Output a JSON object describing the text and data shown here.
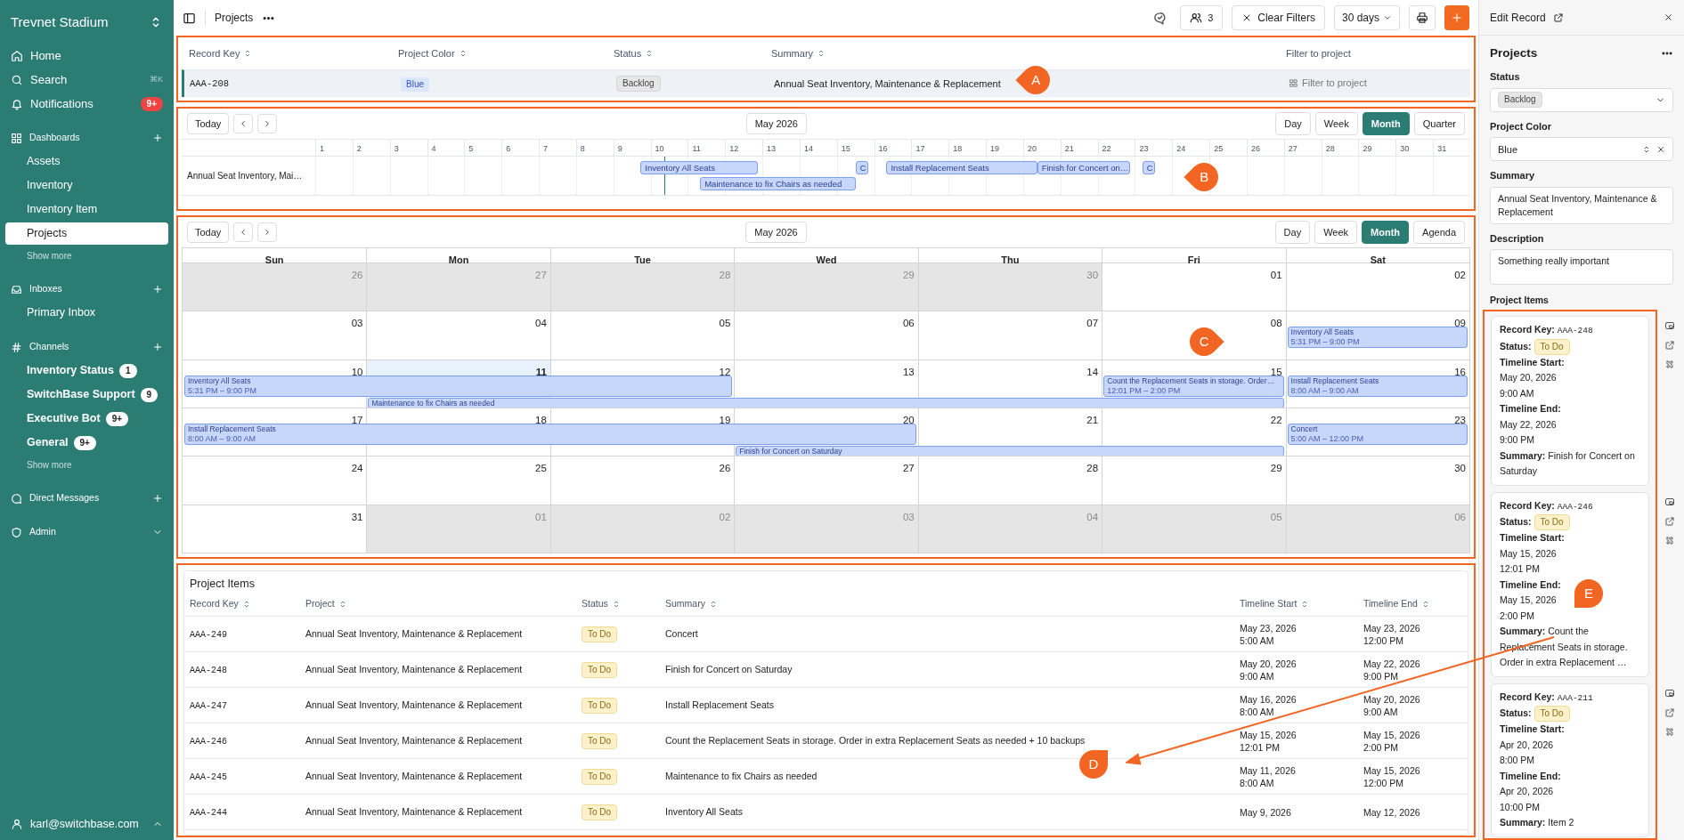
{
  "sidebar": {
    "workspace": "Trevnet Stadium",
    "nav": [
      {
        "kind": "home",
        "label": "Home"
      },
      {
        "kind": "search",
        "label": "Search",
        "shortcut": "⌘K"
      },
      {
        "kind": "bell",
        "label": "Notifications",
        "badge": "9+"
      }
    ],
    "groups": [
      {
        "kind": "dashboard",
        "title": "Dashboards",
        "items": [
          {
            "label": "Assets",
            "selected": false
          },
          {
            "label": "Inventory",
            "selected": false
          },
          {
            "label": "Inventory Item",
            "selected": false
          },
          {
            "label": "Projects",
            "selected": true
          }
        ],
        "more": "Show more"
      },
      {
        "kind": "inbox",
        "title": "Inboxes",
        "items": [
          {
            "label": "Primary Inbox",
            "selected": false
          }
        ]
      },
      {
        "kind": "hash",
        "title": "Channels",
        "items": [
          {
            "label": "Inventory Status",
            "badge": "1",
            "selected": false,
            "unread": true
          },
          {
            "label": "SwitchBase Support",
            "badge": "9",
            "selected": false,
            "unread": true
          },
          {
            "label": "Executive Bot",
            "badge": "9+",
            "selected": false,
            "unread": true
          },
          {
            "label": "General",
            "badge": "9+",
            "selected": false,
            "unread": true
          }
        ],
        "more": "Show more"
      },
      {
        "kind": "chat",
        "title": "Direct Messages"
      },
      {
        "kind": "shield",
        "title": "Admin"
      }
    ],
    "user": "karl@switchbase.com"
  },
  "topbar": {
    "title": "Projects",
    "members": "3",
    "clear_filters": "Clear Filters",
    "range": "30 days"
  },
  "record_table": {
    "columns": [
      {
        "label": "Record Key",
        "sortable": true
      },
      {
        "label": "Project Color",
        "sortable": true
      },
      {
        "label": "Status",
        "sortable": true
      },
      {
        "label": "Summary",
        "sortable": true
      },
      {
        "label": "Filter to project",
        "sortable": false
      }
    ],
    "rows": [
      {
        "selected": true,
        "record_key": "AAA-208",
        "project_color": "Blue",
        "status": {
          "label": "Backlog",
          "kind": "backlog"
        },
        "summary": "Annual Seat Inventory, Maintenance & Replacement",
        "filter_link": "Filter to project"
      }
    ]
  },
  "timeline": {
    "today": "Today",
    "period": "May 2026",
    "views": [
      {
        "label": "Day",
        "selected": false
      },
      {
        "label": "Week",
        "selected": false
      },
      {
        "label": "Month",
        "selected": true
      },
      {
        "label": "Quarter",
        "selected": false
      }
    ],
    "days": [
      "1",
      "2",
      "3",
      "4",
      "5",
      "6",
      "7",
      "8",
      "9",
      "10",
      "11",
      "12",
      "13",
      "14",
      "15",
      "16",
      "17",
      "18",
      "19",
      "20",
      "21",
      "22",
      "23",
      "24",
      "25",
      "26",
      "27",
      "28",
      "29",
      "30",
      "31"
    ],
    "rows": [
      {
        "label": "Annual Seat Inventory, Mai…",
        "bars": [
          {
            "title": "Inventory All Seats"
          },
          {
            "title": "Maintenance to fix Chairs as needed"
          },
          {
            "title": "C"
          },
          {
            "title": "Install Replacement Seats"
          },
          {
            "title": "Finish for Concert on…"
          },
          {
            "title": "C"
          }
        ]
      }
    ]
  },
  "calendar": {
    "today": "Today",
    "period": "May 2026",
    "views": [
      {
        "label": "Day",
        "selected": false
      },
      {
        "label": "Week",
        "selected": false
      },
      {
        "label": "Month",
        "selected": true
      },
      {
        "label": "Agenda",
        "selected": false
      }
    ],
    "weekdays": [
      "Sun",
      "Mon",
      "Tue",
      "Wed",
      "Thu",
      "Fri",
      "Sat"
    ],
    "weeks": [
      {
        "days": [
          {
            "date": "26",
            "outside": true,
            "today": false
          },
          {
            "date": "27",
            "outside": true,
            "today": false
          },
          {
            "date": "28",
            "outside": true,
            "today": false
          },
          {
            "date": "29",
            "outside": true,
            "today": false
          },
          {
            "date": "30",
            "outside": true,
            "today": false
          },
          {
            "date": "01",
            "outside": false,
            "today": false
          },
          {
            "date": "02",
            "outside": false,
            "today": false
          }
        ]
      },
      {
        "days": [
          {
            "date": "03",
            "outside": false,
            "today": false
          },
          {
            "date": "04",
            "outside": false,
            "today": false
          },
          {
            "date": "05",
            "outside": false,
            "today": false
          },
          {
            "date": "06",
            "outside": false,
            "today": false
          },
          {
            "date": "07",
            "outside": false,
            "today": false
          },
          {
            "date": "08",
            "outside": false,
            "today": false
          },
          {
            "date": "09",
            "outside": false,
            "today": false
          }
        ],
        "events": [
          {
            "title": "Inventory All Seats",
            "time": "5:31 PM – 9:00 PM"
          }
        ]
      },
      {
        "days": [
          {
            "date": "10",
            "outside": false,
            "today": false
          },
          {
            "date": "11",
            "outside": false,
            "today": true
          },
          {
            "date": "12",
            "outside": false,
            "today": false
          },
          {
            "date": "13",
            "outside": false,
            "today": false
          },
          {
            "date": "14",
            "outside": false,
            "today": false
          },
          {
            "date": "15",
            "outside": false,
            "today": false
          },
          {
            "date": "16",
            "outside": false,
            "today": false
          }
        ],
        "events": [
          {
            "title": "Inventory All Seats",
            "time": "5:31 PM – 9:00 PM"
          },
          {
            "title": "Count the Replacement Seats in storage. Order…",
            "time": "12:01 PM – 2:00 PM"
          },
          {
            "title": "Install Replacement Seats",
            "time": "8:00 AM – 9:00 AM"
          },
          {
            "title": "Maintenance to fix Chairs as needed"
          }
        ]
      },
      {
        "days": [
          {
            "date": "17",
            "outside": false,
            "today": false
          },
          {
            "date": "18",
            "outside": false,
            "today": false
          },
          {
            "date": "19",
            "outside": false,
            "today": false
          },
          {
            "date": "20",
            "outside": false,
            "today": false
          },
          {
            "date": "21",
            "outside": false,
            "today": false
          },
          {
            "date": "22",
            "outside": false,
            "today": false
          },
          {
            "date": "23",
            "outside": false,
            "today": false
          }
        ],
        "events": [
          {
            "title": "Install Replacement Seats",
            "time": "8:00 AM – 9:00 AM"
          },
          {
            "title": "Concert",
            "time": "5:00 AM – 12:00 PM"
          },
          {
            "title": "Finish for Concert on Saturday"
          }
        ]
      },
      {
        "days": [
          {
            "date": "24",
            "outside": false,
            "today": false
          },
          {
            "date": "25",
            "outside": false,
            "today": false
          },
          {
            "date": "26",
            "outside": false,
            "today": false
          },
          {
            "date": "27",
            "outside": false,
            "today": false
          },
          {
            "date": "28",
            "outside": false,
            "today": false
          },
          {
            "date": "29",
            "outside": false,
            "today": false
          },
          {
            "date": "30",
            "outside": false,
            "today": false
          }
        ]
      },
      {
        "days": [
          {
            "date": "31",
            "outside": false,
            "today": false
          },
          {
            "date": "01",
            "outside": true,
            "today": false
          },
          {
            "date": "02",
            "outside": true,
            "today": false
          },
          {
            "date": "03",
            "outside": true,
            "today": false
          },
          {
            "date": "04",
            "outside": true,
            "today": false
          },
          {
            "date": "05",
            "outside": true,
            "today": false
          },
          {
            "date": "06",
            "outside": true,
            "today": false
          }
        ]
      }
    ]
  },
  "project_items": {
    "title": "Project Items",
    "columns": [
      "Record Key",
      "Project",
      "Status",
      "Summary",
      "Timeline Start",
      "Timeline End"
    ],
    "rows": [
      {
        "record_key": "AAA-249",
        "project": "Annual Seat Inventory, Maintenance & Replacement",
        "status": {
          "label": "To Do",
          "kind": "todo"
        },
        "summary": "Concert",
        "start": [
          "May 23, 2026",
          "5:00 AM"
        ],
        "end": [
          "May 23, 2026",
          "12:00 PM"
        ]
      },
      {
        "record_key": "AAA-248",
        "project": "Annual Seat Inventory, Maintenance & Replacement",
        "status": {
          "label": "To Do",
          "kind": "todo"
        },
        "summary": "Finish for Concert on Saturday",
        "start": [
          "May 20, 2026",
          "9:00 AM"
        ],
        "end": [
          "May 22, 2026",
          "9:00 PM"
        ]
      },
      {
        "record_key": "AAA-247",
        "project": "Annual Seat Inventory, Maintenance & Replacement",
        "status": {
          "label": "To Do",
          "kind": "todo"
        },
        "summary": "Install Replacement Seats",
        "start": [
          "May 16, 2026",
          "8:00 AM"
        ],
        "end": [
          "May 20, 2026",
          "9:00 AM"
        ]
      },
      {
        "record_key": "AAA-246",
        "project": "Annual Seat Inventory, Maintenance & Replacement",
        "status": {
          "label": "To Do",
          "kind": "todo"
        },
        "summary": "Count the Replacement Seats in storage. Order in extra Replacement Seats as needed + 10 backups",
        "start": [
          "May 15, 2026",
          "12:01 PM"
        ],
        "end": [
          "May 15, 2026",
          "2:00 PM"
        ]
      },
      {
        "record_key": "AAA-245",
        "project": "Annual Seat Inventory, Maintenance & Replacement",
        "status": {
          "label": "To Do",
          "kind": "todo"
        },
        "summary": "Maintenance to fix Chairs as needed",
        "start": [
          "May 11, 2026",
          "8:00 AM"
        ],
        "end": [
          "May 15, 2026",
          "12:00 PM"
        ]
      },
      {
        "record_key": "AAA-244",
        "project": "Annual Seat Inventory, Maintenance & Replacement",
        "status": {
          "label": "To Do",
          "kind": "todo"
        },
        "summary": "Inventory All Seats",
        "start": [
          "May 9, 2026"
        ],
        "end": [
          "May 12, 2026"
        ]
      }
    ]
  },
  "edit_panel": {
    "header": "Edit Record",
    "form_title": "Projects",
    "fields": [
      {
        "kind": "select",
        "label": "Status",
        "status": {
          "label": "Backlog",
          "kind": "backlog"
        }
      },
      {
        "kind": "combo",
        "label": "Project Color",
        "value": "Blue"
      },
      {
        "kind": "textarea",
        "label": "Summary",
        "value": "Annual Seat Inventory, Maintenance & Replacement"
      },
      {
        "kind": "textarea",
        "label": "Description",
        "value": "Something really important"
      }
    ],
    "items_title": "Project Items",
    "cards": [
      {
        "fields": [
          {
            "kind": "code",
            "label": "Record Key:",
            "value": "AAA-248"
          },
          {
            "kind": "badge",
            "label": "Status:",
            "status": {
              "label": "To Do",
              "kind": "todo"
            }
          },
          {
            "kind": "stacked",
            "label": "Timeline Start:",
            "lines": [
              "May 20, 2026",
              "9:00 AM"
            ]
          },
          {
            "kind": "stacked",
            "label": "Timeline End:",
            "lines": [
              "May 22, 2026",
              "9:00 PM"
            ]
          },
          {
            "kind": "inline",
            "label": "Summary:",
            "value": "Finish for Concert on Saturday"
          }
        ]
      },
      {
        "fields": [
          {
            "kind": "code",
            "label": "Record Key:",
            "value": "AAA-246"
          },
          {
            "kind": "badge",
            "label": "Status:",
            "status": {
              "label": "To Do",
              "kind": "todo"
            }
          },
          {
            "kind": "stacked",
            "label": "Timeline Start:",
            "lines": [
              "May 15, 2026",
              "12:01 PM"
            ]
          },
          {
            "kind": "stacked",
            "label": "Timeline End:",
            "lines": [
              "May 15, 2026",
              "2:00 PM"
            ]
          },
          {
            "kind": "inline",
            "label": "Summary:",
            "value": "Count the Replacement Seats in storage. Order in extra Replacement …"
          }
        ]
      },
      {
        "fields": [
          {
            "kind": "code",
            "label": "Record Key:",
            "value": "AAA-211"
          },
          {
            "kind": "badge",
            "label": "Status:",
            "status": {
              "label": "To Do",
              "kind": "todo"
            }
          },
          {
            "kind": "stacked",
            "label": "Timeline Start:",
            "lines": [
              "Apr 20, 2026",
              "8:00 PM"
            ]
          },
          {
            "kind": "stacked",
            "label": "Timeline End:",
            "lines": [
              "Apr 20, 2026",
              "10:00 PM"
            ]
          },
          {
            "kind": "inline",
            "label": "Summary:",
            "value": "Item 2"
          }
        ]
      }
    ]
  },
  "annotations": [
    {
      "label": "A"
    },
    {
      "label": "B"
    },
    {
      "label": "C"
    },
    {
      "label": "D"
    },
    {
      "label": "E"
    }
  ]
}
